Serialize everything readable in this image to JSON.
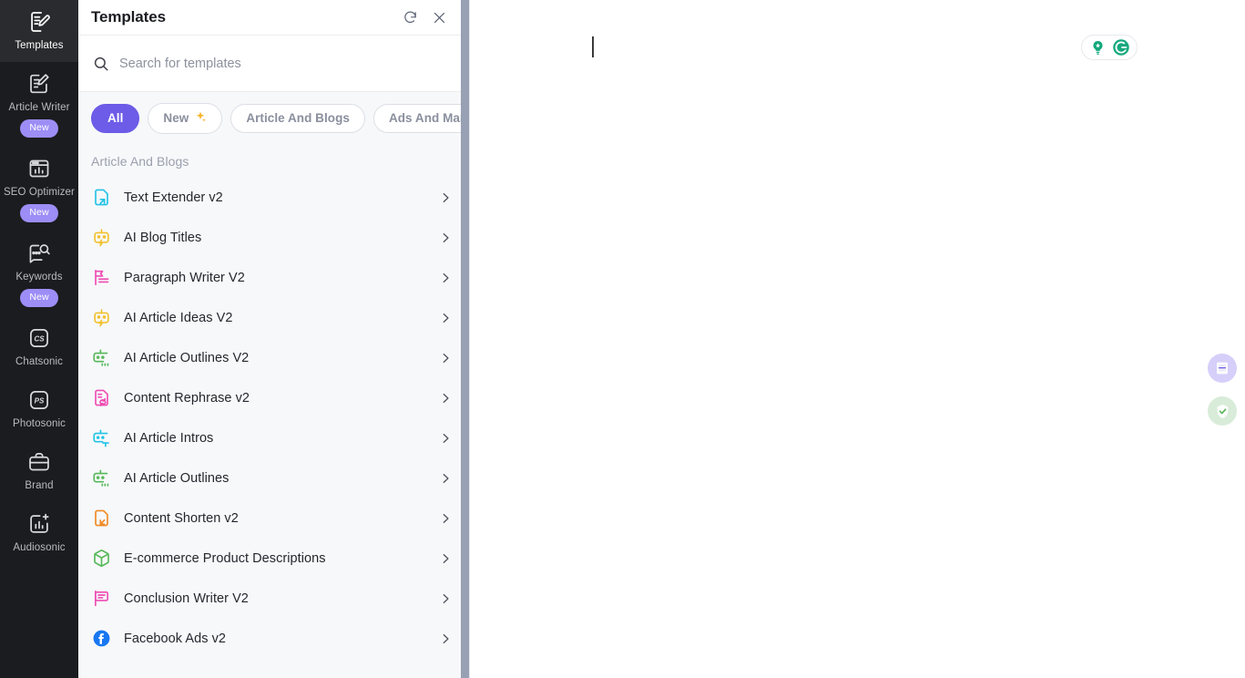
{
  "rail": {
    "items": [
      {
        "label": "Templates",
        "icon": "document-edit-icon",
        "badge": null,
        "active": true
      },
      {
        "label": "Article Writer",
        "icon": "article-edit-icon",
        "badge": "New",
        "active": false
      },
      {
        "label": "SEO Optimizer",
        "icon": "seo-chart-icon",
        "badge": "New",
        "active": false
      },
      {
        "label": "Keywords",
        "icon": "keyword-search-icon",
        "badge": "New",
        "active": false
      },
      {
        "label": "Chatsonic",
        "icon": "chatsonic-cs-icon",
        "badge": null,
        "active": false
      },
      {
        "label": "Photosonic",
        "icon": "photosonic-ps-icon",
        "badge": null,
        "active": false
      },
      {
        "label": "Brand",
        "icon": "briefcase-icon",
        "badge": null,
        "active": false
      },
      {
        "label": "Audiosonic",
        "icon": "audiosonic-bars-icon",
        "badge": null,
        "active": false
      }
    ]
  },
  "panel": {
    "title": "Templates",
    "refresh_label": "refresh-icon",
    "close_label": "close-icon",
    "search": {
      "placeholder": "Search for templates",
      "value": ""
    },
    "chips": [
      {
        "label": "All",
        "active": true,
        "sparkle": false
      },
      {
        "label": "New",
        "active": false,
        "sparkle": true
      },
      {
        "label": "Article And Blogs",
        "active": false,
        "sparkle": false
      },
      {
        "label": "Ads And Marketing",
        "active": false,
        "sparkle": false
      }
    ],
    "section_label": "Article And Blogs",
    "items": [
      {
        "label": "Text Extender v2",
        "icon": "text-extender-icon",
        "color": "#22c3e6"
      },
      {
        "label": "AI Blog Titles",
        "icon": "ai-bot-bolt-icon",
        "color": "#f2c12e"
      },
      {
        "label": "Paragraph Writer V2",
        "icon": "paragraph-lines-icon",
        "color": "#ee4db3"
      },
      {
        "label": "AI Article Ideas V2",
        "icon": "ai-bot-bolt-icon",
        "color": "#f2c12e"
      },
      {
        "label": "AI Article Outlines V2",
        "icon": "ai-bot-dots-icon",
        "color": "#57b85a"
      },
      {
        "label": "Content Rephrase v2",
        "icon": "rephrase-doc-icon",
        "color": "#ee4db3"
      },
      {
        "label": "AI Article Intros",
        "icon": "ai-bot-text-icon",
        "color": "#22c3e6"
      },
      {
        "label": "AI Article Outlines",
        "icon": "ai-bot-dots-icon",
        "color": "#57b85a"
      },
      {
        "label": "Content Shorten v2",
        "icon": "content-shorten-icon",
        "color": "#f08a24"
      },
      {
        "label": "E-commerce Product Descriptions",
        "icon": "package-box-icon",
        "color": "#57b85a"
      },
      {
        "label": "Conclusion Writer V2",
        "icon": "flag-text-icon",
        "color": "#ee4db3"
      },
      {
        "label": "Facebook Ads v2",
        "icon": "facebook-icon",
        "color": "#1877f2"
      }
    ]
  },
  "editor": {
    "content": "",
    "caret_visible": true
  },
  "grammarly": {
    "bulb_label": "lightbulb-icon",
    "logo_label": "grammarly-logo-icon"
  },
  "float_buttons": [
    {
      "name": "document-outline-button",
      "icon": "document-lines-icon",
      "color": "#d5cffa"
    },
    {
      "name": "plagiarism-check-button",
      "icon": "shield-check-icon",
      "color": "#d8ecd9"
    }
  ],
  "colors": {
    "accent_purple": "#6c5ce7",
    "rail_background": "#1b1c1f",
    "panel_background": "#f7f8fa",
    "badge_purple": "#9d8df6",
    "grammarly_green": "#15a87d"
  }
}
